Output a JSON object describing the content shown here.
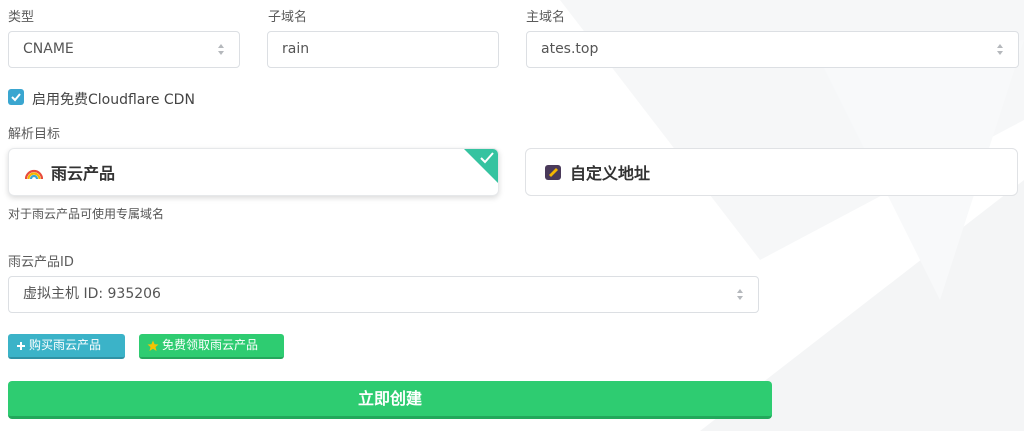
{
  "form": {
    "type": {
      "label": "类型",
      "value": "CNAME"
    },
    "subdomain": {
      "label": "子域名",
      "value": "rain"
    },
    "main_domain": {
      "label": "主域名",
      "value": "ates.top"
    },
    "cdn_checkbox": {
      "label": "启用免费Cloudflare CDN",
      "checked": true
    },
    "target": {
      "label": "解析目标",
      "options": [
        {
          "label": "雨云产品",
          "icon": "rainbow-icon",
          "selected": true
        },
        {
          "label": "自定义地址",
          "icon": "note-icon",
          "selected": false
        }
      ],
      "helper": "对于雨云产品可使用专属域名"
    },
    "product_id": {
      "label": "雨云产品ID",
      "value": "虚拟主机 ID: 935206"
    },
    "buttons": {
      "buy": {
        "label": "购买雨云产品",
        "icon": "plus-icon"
      },
      "free": {
        "label": "免费领取雨云产品",
        "icon": "star-icon"
      },
      "create": {
        "label": "立即创建"
      }
    }
  },
  "colors": {
    "accent_blue": "#3bb3c8",
    "accent_green": "#2ecc71",
    "selected_corner": "#35c3a0",
    "checkbox": "#3aa6d0"
  }
}
